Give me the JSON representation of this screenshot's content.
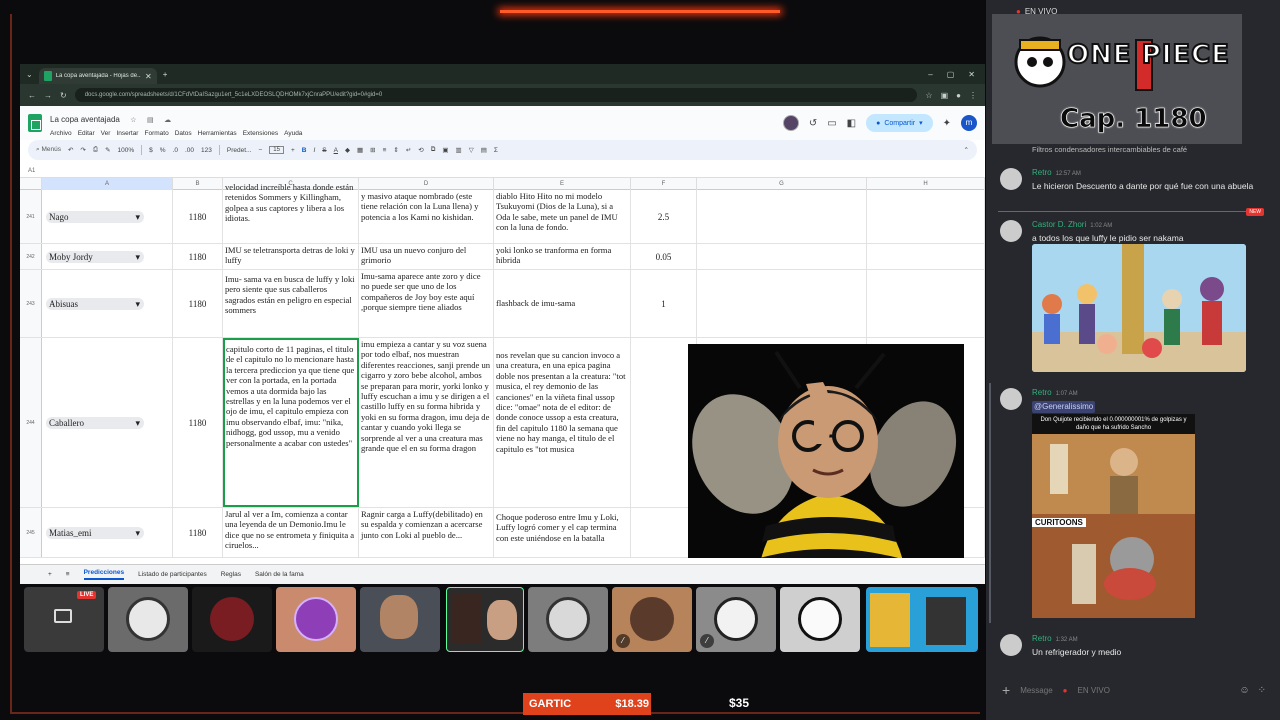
{
  "browser": {
    "tab_title": "La copa aventajada - Hojas de...",
    "url": "docs.google.com/spreadsheets/d/1CFdVtDaISazgu1ert_5c1eLXDEOSLQDHOMk7xjCnraPPU/edit?gid=0#gid=0"
  },
  "doc": {
    "title": "La copa aventajada",
    "menu": [
      "Archivo",
      "Editar",
      "Ver",
      "Insertar",
      "Formato",
      "Datos",
      "Herramientas",
      "Extensiones",
      "Ayuda"
    ],
    "share_label": "Compartir",
    "user_initial": "m"
  },
  "toolbar": {
    "search": "Menús",
    "zoom": "100%",
    "currency": "$",
    "percent": "%",
    "font": "Predet...",
    "size": "15",
    "bold": "B",
    "italic": "I",
    "strike": "S",
    "text_color": "A"
  },
  "formula_ref": "A1",
  "columns": [
    "A",
    "B",
    "C",
    "D",
    "E",
    "F",
    "G",
    "H"
  ],
  "rows": [
    {
      "num": "241",
      "name": "Nago",
      "chapter": "1180",
      "c": "velocidad increíble hasta donde están retenidos Sommers y Killingham, golpea a sus captores y libera a los idiotas.",
      "d": "y masivo ataque nombrado (este tiene relación con la Luna llena) y potencia a los Kami no kishidan.",
      "e": "diablo Hito Hito no mi modelo Tsukuyomi (Dios de la Luna), si a Oda le sabe, mete un panel de IMU con la luna de fondo.",
      "f": "2.5"
    },
    {
      "num": "242",
      "name": "Moby Jordy",
      "chapter": "1180",
      "c": "IMU se teletransporta detras de loki y luffy",
      "d": "IMU usa un nuevo conjuro del grimorio",
      "e": "yoki lonko se tranforma en forma hibrida",
      "f": "0.05"
    },
    {
      "num": "243",
      "name": "Abisuas",
      "chapter": "1180",
      "c": "Imu- sama va en busca de luffy y loki pero siente que sus caballeros sagrados están en peligro en especial sommers",
      "d": "Imu-sama aparece ante zoro y dice no puede ser que uno de los compañeros de Joy boy este aquí ,porque siempre tiene aliados",
      "e": "flashback de imu-sama",
      "f": "1"
    },
    {
      "num": "244",
      "name": "Caballero",
      "chapter": "1180",
      "c": "capitulo corto de 11 paginas, el titulo de el capitulo no lo mencionare hasta la tercera prediccion ya que tiene que ver con la portada, en la portada vemos a uta dormida bajo las estrellas y en la luna podemos ver el ojo de imu, el capitulo empieza con imu observando elbaf, imu: \"nika, nidhogg, god ussop, mu a venido personalmente a acabar con ustedes\"",
      "d": "imu empieza a cantar y su voz suena por todo elbaf, nos muestran diferentes reacciones, sanji prende un cigarro y zoro bebe alcohol, ambos se preparan para morir, yorki lonko y luffy escuchan a imu y se dirigen a el castillo luffy en su forma hibrida y yoki en su forma dragon, imu deja de cantar y cuando yoki llega se sorprende al ver a una creatura mas grande que el en su forma dragon",
      "e": "nos revelan que su cancion invoco a una creatura, en una epica pagina doble nos presentan a la creatura: \"tot musica, el rey demonio de las canciones\" en la viñeta final ussop dice: \"omae\" nota de el editor: de donde conoce ussop a esta creatura, fin del capitulo 1180 la semana que viene no hay manga, el titulo de el capitulo es \"tot musica",
      "f": ""
    },
    {
      "num": "245",
      "name": "Matias_emi",
      "chapter": "1180",
      "c": "Jarul al ver a Im, comienza a contar una leyenda de un Demonio.Imu le dice que no se entrometa y finiquita a ciruelos...",
      "d": "Ragnir carga a Luffy(debilitado) en su espalda y comienzan a acercarse junto con Loki al pueblo de...",
      "e": "Choque poderoso entre Imu y Loki, Luffy logró comer y el cap termina con este uniéndose en la batalla",
      "f": ""
    }
  ],
  "sheet_tabs": [
    "Predicciones",
    "Listado de participantes",
    "Reglas",
    "Salón de la fama"
  ],
  "tiles": {
    "live_label": "LIVE"
  },
  "goals": {
    "gartic_label": "GARTIC",
    "gartic_amount": "$18.39",
    "second_amount": "$35"
  },
  "chat": {
    "top_label": "EN VIVO",
    "logo_title": "ONE PIECE",
    "logo_cap": "Cap. 1180",
    "partial_text": "Filtros condensadores intercambiables de café",
    "messages": [
      {
        "user": "Retro",
        "time": "12:57 AM",
        "text": "Le hicieron Descuento a dante por qué fue con una abuela"
      },
      {
        "user": "Castor D. Zhori",
        "time": "1:02 AM",
        "text": "a todos los que luffy le pidio ser nakama"
      },
      {
        "user": "Retro",
        "time": "1:07 AM",
        "mention": "@Generalissimo"
      },
      {
        "user": "Retro",
        "time": "1:32 AM",
        "text": "Un refrigerador y medio"
      }
    ],
    "new_label": "NEW",
    "meme_caption": "Don Quijote recibiendo el 0.000000001% de golpizas y daño que ha sufrido Sancho",
    "meme_brand": "CURITOONS",
    "input_placeholder": "Message",
    "input_status": "EN VIVO"
  }
}
